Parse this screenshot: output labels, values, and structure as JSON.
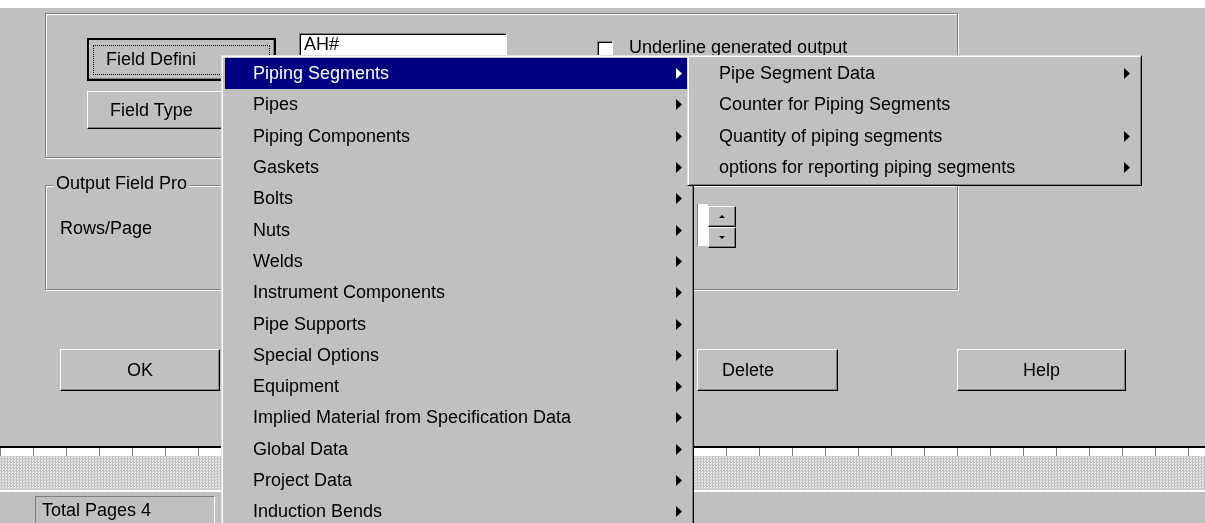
{
  "dialog": {
    "field_definition_button": "Field Defini",
    "field_type_button": "Field Type",
    "field_value": "AH#",
    "underline_checkbox": {
      "label": "Underline generated output",
      "checked": false
    },
    "output_group": {
      "title": "Output Field Pro",
      "rows_label": "Rows/Page"
    },
    "buttons": [
      {
        "label": "OK"
      },
      {
        "label": "Delete"
      },
      {
        "label": "Help"
      }
    ]
  },
  "status_bar": {
    "total_pages": "Total Pages 4"
  },
  "menu": {
    "items": [
      {
        "label": "Piping Segments",
        "selected": true,
        "has_submenu": true
      },
      {
        "label": "Pipes",
        "selected": false,
        "has_submenu": true
      },
      {
        "label": "Piping Components",
        "selected": false,
        "has_submenu": true
      },
      {
        "label": "Gaskets",
        "selected": false,
        "has_submenu": true
      },
      {
        "label": "Bolts",
        "selected": false,
        "has_submenu": true
      },
      {
        "label": "Nuts",
        "selected": false,
        "has_submenu": true
      },
      {
        "label": "Welds",
        "selected": false,
        "has_submenu": true
      },
      {
        "label": "Instrument Components",
        "selected": false,
        "has_submenu": true
      },
      {
        "label": "Pipe Supports",
        "selected": false,
        "has_submenu": true
      },
      {
        "label": "Special Options",
        "selected": false,
        "has_submenu": true
      },
      {
        "label": "Equipment",
        "selected": false,
        "has_submenu": true
      },
      {
        "label": "Implied Material from Specification Data",
        "selected": false,
        "has_submenu": true
      },
      {
        "label": "Global Data",
        "selected": false,
        "has_submenu": true
      },
      {
        "label": "Project Data",
        "selected": false,
        "has_submenu": true
      },
      {
        "label": "Induction Bends",
        "selected": false,
        "has_submenu": true
      }
    ]
  },
  "submenu": {
    "items": [
      {
        "label": "Pipe Segment Data",
        "selected": false,
        "has_submenu": true
      },
      {
        "label": "Counter for Piping Segments",
        "selected": false,
        "has_submenu": false
      },
      {
        "label": "Quantity of piping segments",
        "selected": false,
        "has_submenu": true
      },
      {
        "label": "options for reporting piping segments",
        "selected": false,
        "has_submenu": true
      }
    ]
  }
}
